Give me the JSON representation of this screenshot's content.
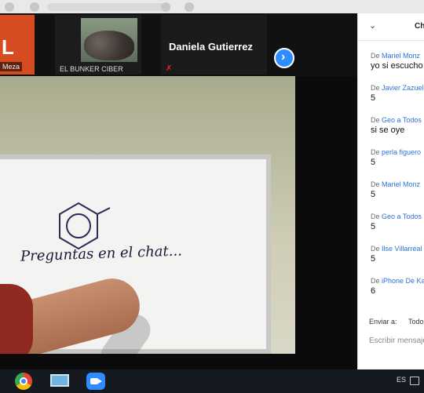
{
  "participants": [
    {
      "letter": "L",
      "name": "Meza"
    },
    {
      "name": "EL BUNKER CIBER"
    },
    {
      "name": "Daniela Gutierrez"
    }
  ],
  "next_label": "›",
  "whiteboard": {
    "text": "Preguntas en el chat..."
  },
  "chat": {
    "title": "Ch",
    "messages": [
      {
        "prefix": "De",
        "sender": "Mariel Monz",
        "text": "yo si escucho"
      },
      {
        "prefix": "De",
        "sender": "Javier Zazuel",
        "text": "5"
      },
      {
        "prefix": "De",
        "sender": "Geo a Todos",
        "text": "si se oye"
      },
      {
        "prefix": "De",
        "sender": "perla figuero",
        "text": "5"
      },
      {
        "prefix": "De",
        "sender": "Mariel Monz",
        "text": "5"
      },
      {
        "prefix": "De",
        "sender": "Geo a Todos",
        "text": "5"
      },
      {
        "prefix": "De",
        "sender": "Ilse Villarreal",
        "text": "5"
      },
      {
        "prefix": "De",
        "sender": "iPhone De Ka",
        "text": "6"
      }
    ],
    "send_to_label": "Enviar a:",
    "send_to_target": "Todos",
    "composer_placeholder": "Escribir mensaje"
  },
  "taskbar": {
    "language": "ES",
    "icons": [
      "chrome-icon",
      "computer-icon",
      "zoom-icon"
    ]
  }
}
